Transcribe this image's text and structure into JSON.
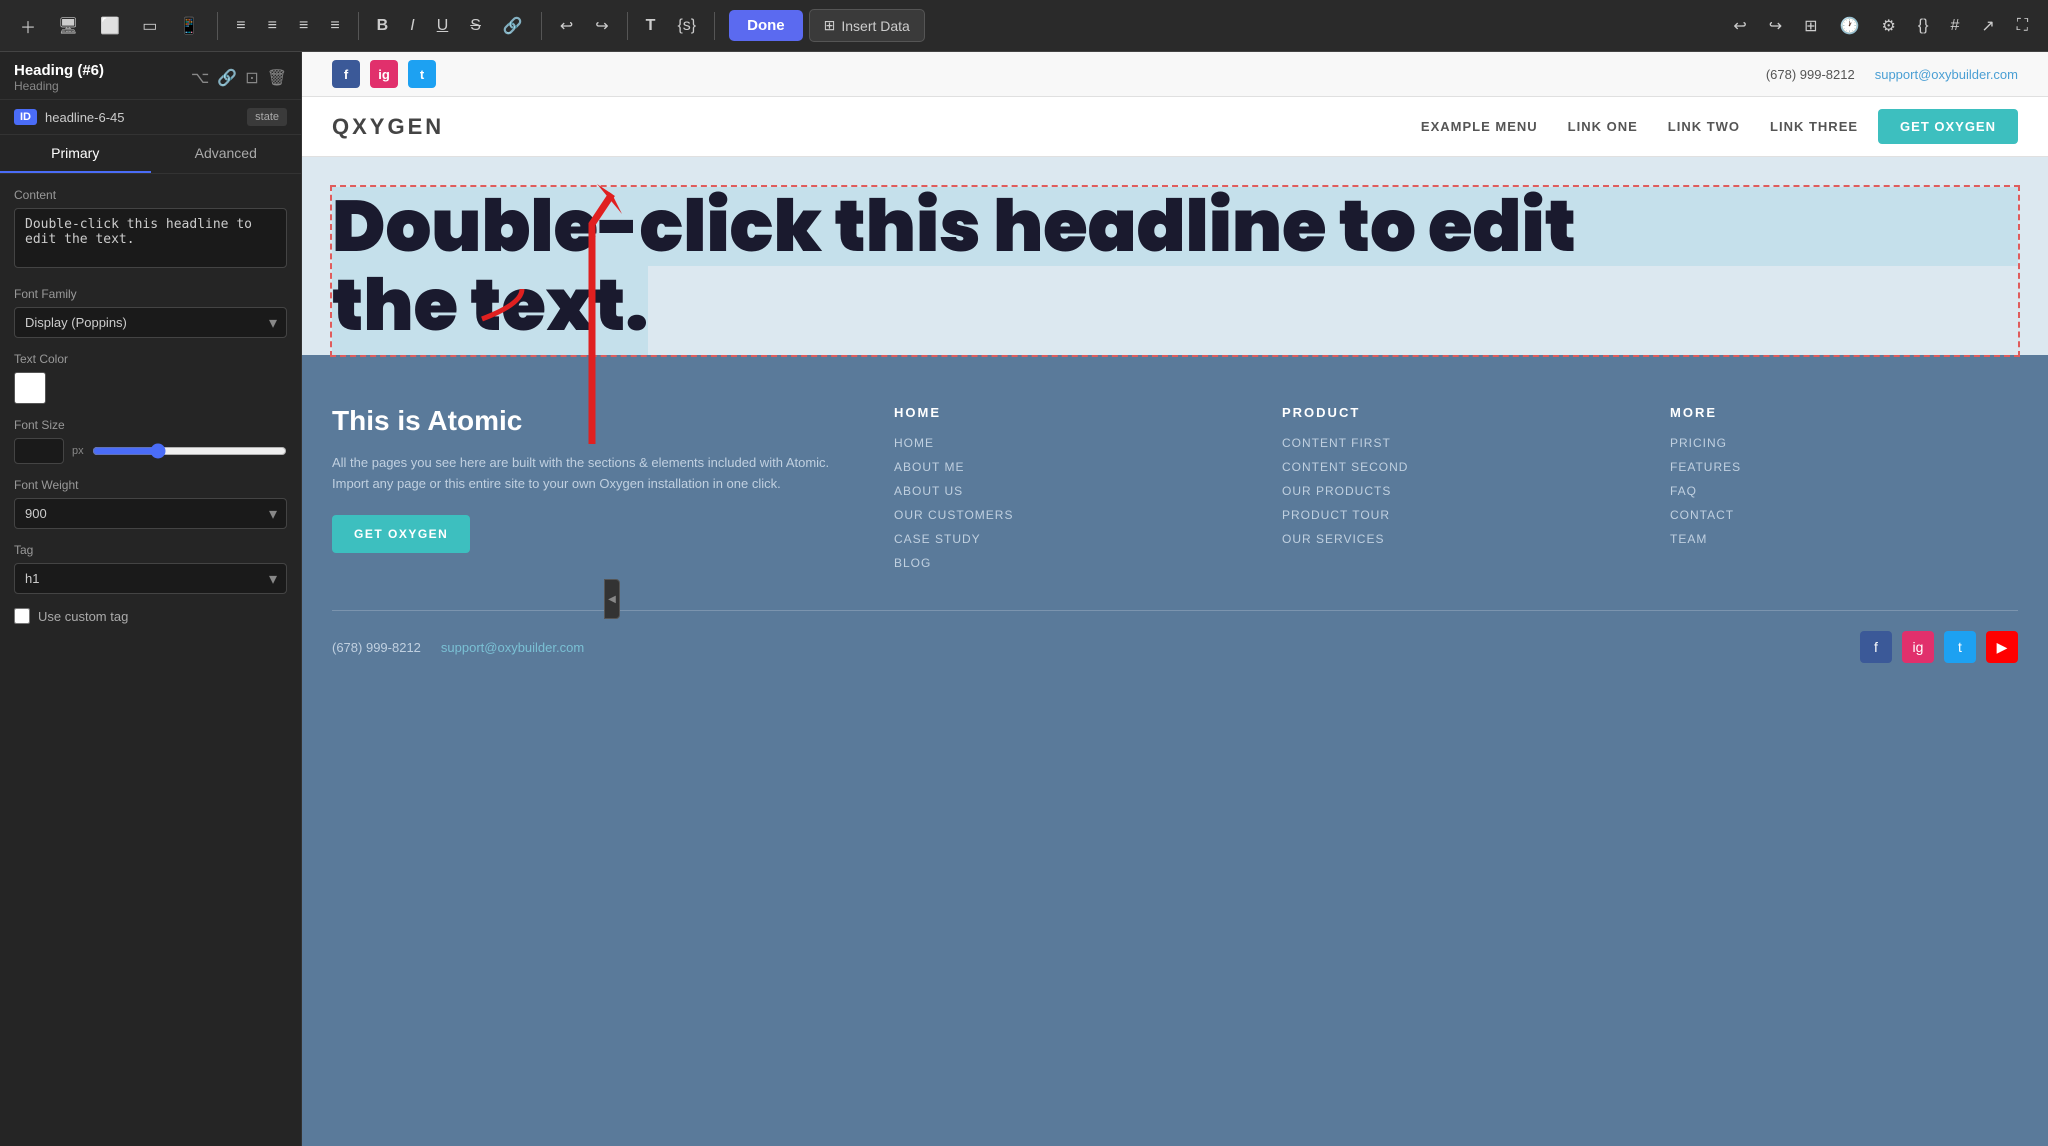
{
  "toolbar": {
    "align_left": "≡",
    "align_center": "≡",
    "align_right": "≡",
    "align_justify": "≡",
    "bold": "B",
    "italic": "I",
    "underline": "U",
    "strikethrough": "S",
    "link": "🔗",
    "undo": "↩",
    "redo": "↪",
    "text": "T",
    "code": "{s}",
    "done_label": "Done",
    "insert_data_label": "Insert Data",
    "undo2": "↩",
    "redo2": "↪"
  },
  "left_panel": {
    "title": "Heading (#6)",
    "subtitle": "Heading",
    "id_label": "ID",
    "id_value": "headline-6-45",
    "state_label": "state",
    "tab_primary": "Primary",
    "tab_advanced": "Advanced",
    "content_label": "Content",
    "content_value": "Double-click this headline to edit the text.",
    "font_family_label": "Font Family",
    "font_family_value": "Display (Poppins)",
    "text_color_label": "Text Color",
    "font_size_label": "Font Size",
    "font_size_px": "px",
    "font_weight_label": "Font Weight",
    "tag_label": "Tag",
    "tag_value": "h1",
    "use_custom_tag": "Use custom tag"
  },
  "website": {
    "topbar_phone": "(678) 999-8212",
    "topbar_email": "support@oxybuilder.com",
    "logo": "QXYGEN",
    "nav_links": [
      "EXAMPLE MENU",
      "LINK ONE",
      "LINK TWO",
      "LINK THREE"
    ],
    "nav_cta": "GET OXYGEN",
    "headline": "Double-click this headline to edit the text.",
    "headline_line1": "Double-click this headline to edit",
    "headline_line2": "the text.",
    "footer_brand_title": "This is Atomic",
    "footer_brand_text": "All the pages you see here are built with the sections & elements included with Atomic. Import any page or this entire site to your own Oxygen installation in one click.",
    "footer_cta": "GET OXYGEN",
    "footer_phone": "(678) 999-8212",
    "footer_email": "support@oxybuilder.com",
    "footer_cols": [
      {
        "title": "HOME",
        "links": [
          "HOME",
          "ABOUT ME",
          "ABOUT US",
          "OUR CUSTOMERS",
          "CASE STUDY",
          "BLOG"
        ]
      },
      {
        "title": "PRODUCT",
        "links": [
          "CONTENT FIRST",
          "CONTENT SECOND",
          "OUR PRODUCTS",
          "PRODUCT TOUR",
          "OUR SERVICES"
        ]
      },
      {
        "title": "MORE",
        "links": [
          "PRICING",
          "FEATURES",
          "FAQ",
          "CONTACT",
          "TEAM"
        ]
      }
    ]
  }
}
